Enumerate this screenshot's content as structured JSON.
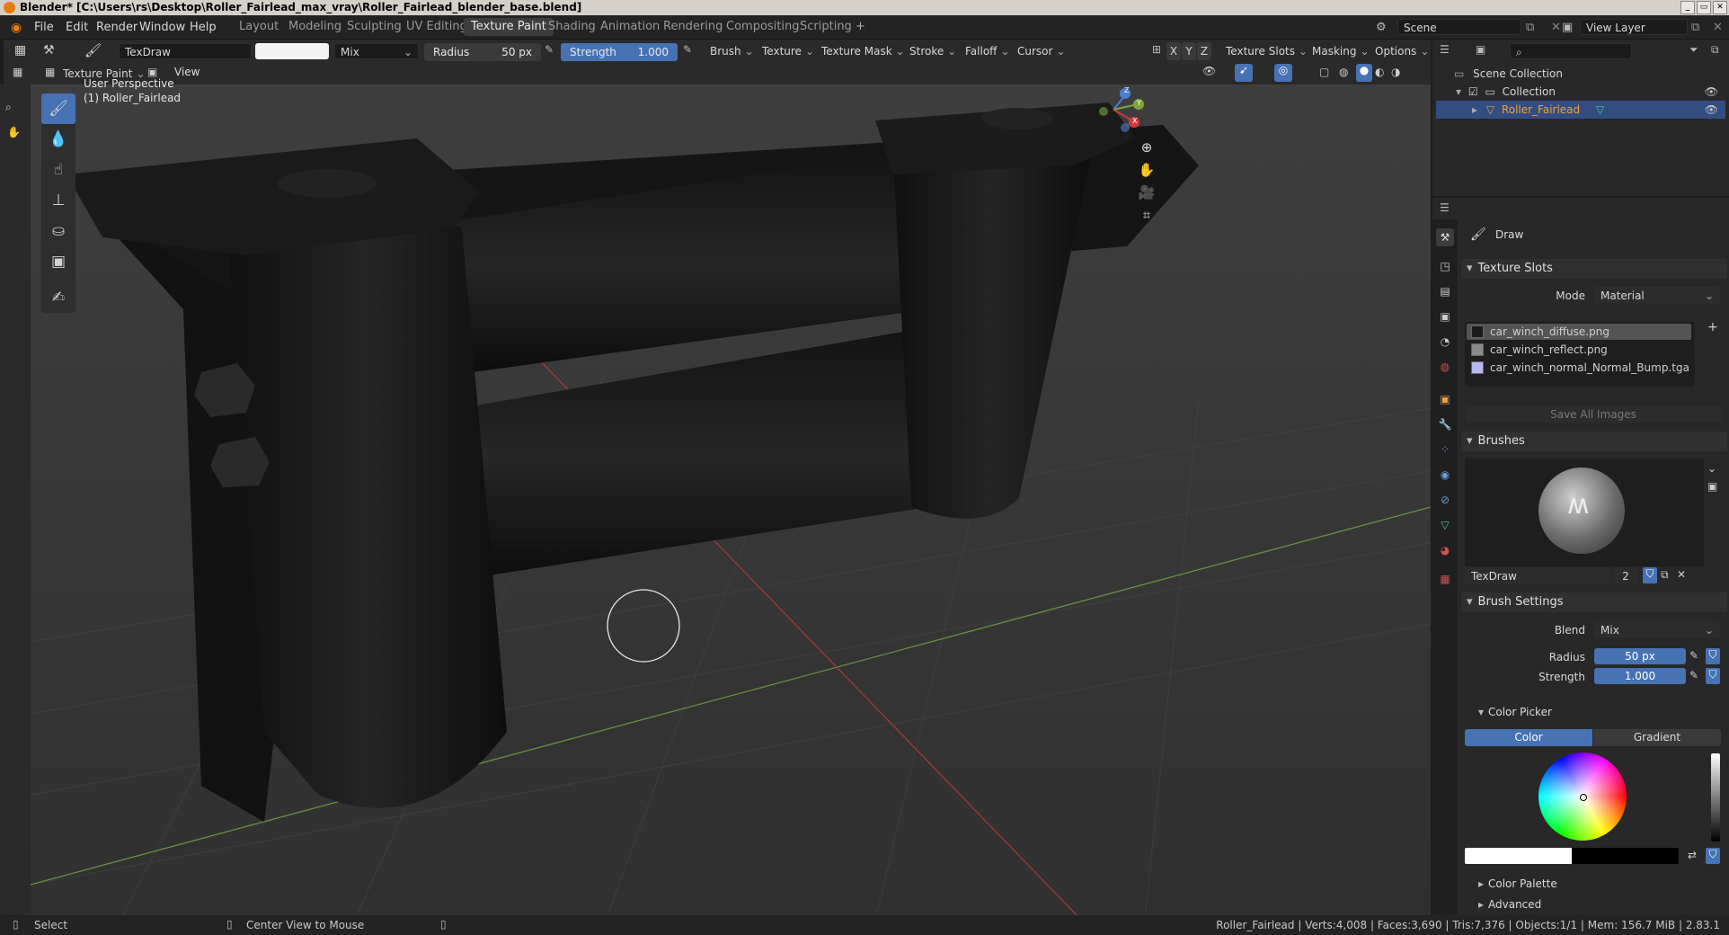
{
  "window": {
    "title": "Blender* [C:\\Users\\rs\\Desktop\\Roller_Fairlead_max_vray\\Roller_Fairlead_blender_base.blend]",
    "controls": [
      "_",
      "▭",
      "✕"
    ]
  },
  "menu": [
    "File",
    "Edit",
    "Render",
    "Window",
    "Help"
  ],
  "workspaces": [
    "Layout",
    "Modeling",
    "Sculpting",
    "UV Editing",
    "Texture Paint",
    "Shading",
    "Animation",
    "Rendering",
    "Compositing",
    "Scripting"
  ],
  "workspace_add": "+",
  "scene": {
    "label": "Scene",
    "view_layer": "View Layer"
  },
  "tool_header": {
    "brush_name": "TexDraw",
    "blend": "Mix",
    "radius_label": "Radius",
    "radius_value": "50 px",
    "strength_label": "Strength",
    "strength_value": "1.000",
    "menus": [
      "Brush",
      "Texture",
      "Texture Mask",
      "Stroke",
      "Falloff",
      "Cursor"
    ],
    "axes": [
      "X",
      "Y",
      "Z"
    ],
    "right_menus": [
      "Texture Slots",
      "Masking",
      "Options"
    ]
  },
  "mode_header": {
    "mode": "Texture Paint",
    "view": "View"
  },
  "viewport": {
    "perspective": "User Perspective",
    "object": "(1) Roller_Fairlead",
    "gizmo": {
      "x": "X",
      "y": "Y",
      "z": "Z"
    }
  },
  "outliner": {
    "root": "Scene Collection",
    "collection": "Collection",
    "object": "Roller_Fairlead"
  },
  "properties": {
    "tool_name": "Draw",
    "texture_slots": {
      "title": "Texture Slots",
      "mode_label": "Mode",
      "mode_value": "Material",
      "items": [
        "car_winch_diffuse.png",
        "car_winch_reflect.png",
        "car_winch_normal_Normal_Bump.tga"
      ],
      "save_all": "Save All Images"
    },
    "brushes": {
      "title": "Brushes",
      "brush_name": "TexDraw",
      "users": "2"
    },
    "brush_settings": {
      "title": "Brush Settings",
      "blend_label": "Blend",
      "blend_value": "Mix",
      "radius_label": "Radius",
      "radius_value": "50 px",
      "strength_label": "Strength",
      "strength_value": "1.000"
    },
    "color_picker": {
      "title": "Color Picker",
      "tab_color": "Color",
      "tab_gradient": "Gradient"
    },
    "color_palette": "Color Palette",
    "advanced": "Advanced"
  },
  "status": {
    "select": "Select",
    "center_view": "Center View to Mouse",
    "stats": "Roller_Fairlead | Verts:4,008 | Faces:3,690 | Tris:7,376 | Objects:1/1 | Mem: 156.7 MiB | 2.83.1"
  },
  "colors": {
    "accent": "#4772b3",
    "selected_row": "#334d80",
    "object_orange": "#e8a04a"
  }
}
